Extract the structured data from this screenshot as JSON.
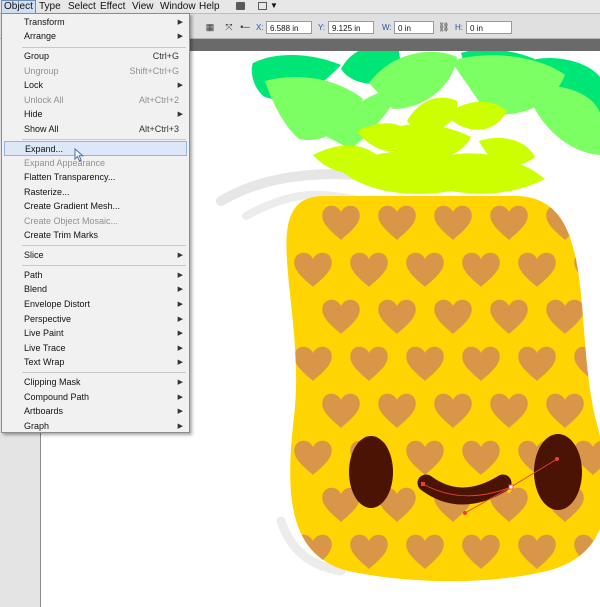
{
  "menubar": {
    "items": [
      "Object",
      "Type",
      "Select",
      "Effect",
      "View",
      "Window",
      "Help"
    ]
  },
  "toolbar": {
    "x_label": "X:",
    "x_value": "6.588 in",
    "y_label": "Y:",
    "y_value": "9.125 in",
    "w_label": "W:",
    "w_value": "0 in",
    "h_label": "H:",
    "h_value": "0 in"
  },
  "object_menu": {
    "items": [
      {
        "label": "Transform",
        "submenu": true
      },
      {
        "label": "Arrange",
        "submenu": true
      },
      {
        "label": "Group",
        "shortcut": "Ctrl+G"
      },
      {
        "label": "Ungroup",
        "shortcut": "Shift+Ctrl+G",
        "disabled": true
      },
      {
        "label": "Lock",
        "submenu": true
      },
      {
        "label": "Unlock All",
        "shortcut": "Alt+Ctrl+2",
        "disabled": true
      },
      {
        "label": "Hide",
        "submenu": true
      },
      {
        "label": "Show All",
        "shortcut": "Alt+Ctrl+3"
      },
      {
        "label": "Expand...",
        "highlighted": true
      },
      {
        "label": "Expand Appearance",
        "disabled": true
      },
      {
        "label": "Flatten Transparency..."
      },
      {
        "label": "Rasterize..."
      },
      {
        "label": "Create Gradient Mesh..."
      },
      {
        "label": "Create Object Mosaic...",
        "disabled": true
      },
      {
        "label": "Create Trim Marks"
      },
      {
        "label": "Slice",
        "submenu": true
      },
      {
        "label": "Path",
        "submenu": true
      },
      {
        "label": "Blend",
        "submenu": true
      },
      {
        "label": "Envelope Distort",
        "submenu": true
      },
      {
        "label": "Perspective",
        "submenu": true
      },
      {
        "label": "Live Paint",
        "submenu": true
      },
      {
        "label": "Live Trace",
        "submenu": true
      },
      {
        "label": "Text Wrap",
        "submenu": true
      },
      {
        "label": "Clipping Mask",
        "submenu": true
      },
      {
        "label": "Compound Path",
        "submenu": true
      },
      {
        "label": "Artboards",
        "submenu": true
      },
      {
        "label": "Graph",
        "submenu": true
      }
    ]
  },
  "colors": {
    "pineapple_body": "#ffd400",
    "heart": "#d99548",
    "eye": "#4a1304",
    "leaf_dark": "#00e676",
    "leaf_mid": "#7cff62",
    "leaf_light": "#ccff00",
    "selection_path": "#e8433a",
    "menu_highlight": "#dce8f7"
  }
}
